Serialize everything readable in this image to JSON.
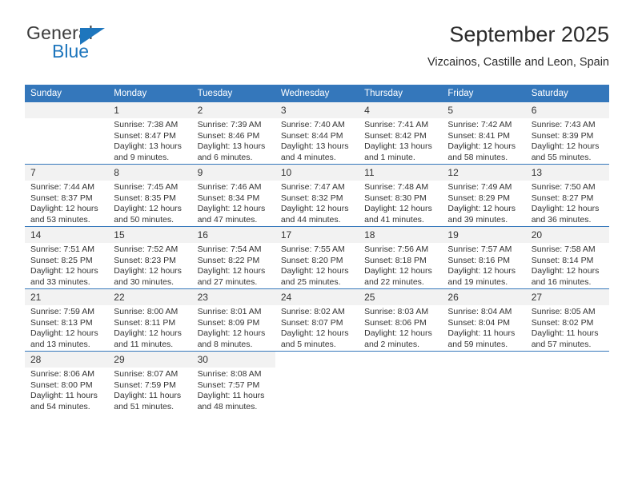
{
  "brand": {
    "name_part1": "General",
    "name_part2": "Blue",
    "triangle_color": "#1e76bd",
    "icon": "triangle-logo-icon"
  },
  "header": {
    "title": "September 2025",
    "subtitle": "Vizcainos, Castille and Leon, Spain"
  },
  "colors": {
    "header_blue": "#3477bb",
    "daynum_band": "#f2f2f2",
    "text": "#333333",
    "brand_blue": "#1e76bd"
  },
  "calendar": {
    "weekday_headers": [
      "Sunday",
      "Monday",
      "Tuesday",
      "Wednesday",
      "Thursday",
      "Friday",
      "Saturday"
    ],
    "labels": {
      "sunrise": "Sunrise:",
      "sunset": "Sunset:",
      "daylight": "Daylight:"
    },
    "weeks": [
      [
        {
          "day": "",
          "sunrise": "",
          "sunset": "",
          "daylight": ""
        },
        {
          "day": "1",
          "sunrise": "Sunrise: 7:38 AM",
          "sunset": "Sunset: 8:47 PM",
          "daylight": "Daylight: 13 hours and 9 minutes."
        },
        {
          "day": "2",
          "sunrise": "Sunrise: 7:39 AM",
          "sunset": "Sunset: 8:46 PM",
          "daylight": "Daylight: 13 hours and 6 minutes."
        },
        {
          "day": "3",
          "sunrise": "Sunrise: 7:40 AM",
          "sunset": "Sunset: 8:44 PM",
          "daylight": "Daylight: 13 hours and 4 minutes."
        },
        {
          "day": "4",
          "sunrise": "Sunrise: 7:41 AM",
          "sunset": "Sunset: 8:42 PM",
          "daylight": "Daylight: 13 hours and 1 minute."
        },
        {
          "day": "5",
          "sunrise": "Sunrise: 7:42 AM",
          "sunset": "Sunset: 8:41 PM",
          "daylight": "Daylight: 12 hours and 58 minutes."
        },
        {
          "day": "6",
          "sunrise": "Sunrise: 7:43 AM",
          "sunset": "Sunset: 8:39 PM",
          "daylight": "Daylight: 12 hours and 55 minutes."
        }
      ],
      [
        {
          "day": "7",
          "sunrise": "Sunrise: 7:44 AM",
          "sunset": "Sunset: 8:37 PM",
          "daylight": "Daylight: 12 hours and 53 minutes."
        },
        {
          "day": "8",
          "sunrise": "Sunrise: 7:45 AM",
          "sunset": "Sunset: 8:35 PM",
          "daylight": "Daylight: 12 hours and 50 minutes."
        },
        {
          "day": "9",
          "sunrise": "Sunrise: 7:46 AM",
          "sunset": "Sunset: 8:34 PM",
          "daylight": "Daylight: 12 hours and 47 minutes."
        },
        {
          "day": "10",
          "sunrise": "Sunrise: 7:47 AM",
          "sunset": "Sunset: 8:32 PM",
          "daylight": "Daylight: 12 hours and 44 minutes."
        },
        {
          "day": "11",
          "sunrise": "Sunrise: 7:48 AM",
          "sunset": "Sunset: 8:30 PM",
          "daylight": "Daylight: 12 hours and 41 minutes."
        },
        {
          "day": "12",
          "sunrise": "Sunrise: 7:49 AM",
          "sunset": "Sunset: 8:29 PM",
          "daylight": "Daylight: 12 hours and 39 minutes."
        },
        {
          "day": "13",
          "sunrise": "Sunrise: 7:50 AM",
          "sunset": "Sunset: 8:27 PM",
          "daylight": "Daylight: 12 hours and 36 minutes."
        }
      ],
      [
        {
          "day": "14",
          "sunrise": "Sunrise: 7:51 AM",
          "sunset": "Sunset: 8:25 PM",
          "daylight": "Daylight: 12 hours and 33 minutes."
        },
        {
          "day": "15",
          "sunrise": "Sunrise: 7:52 AM",
          "sunset": "Sunset: 8:23 PM",
          "daylight": "Daylight: 12 hours and 30 minutes."
        },
        {
          "day": "16",
          "sunrise": "Sunrise: 7:54 AM",
          "sunset": "Sunset: 8:22 PM",
          "daylight": "Daylight: 12 hours and 27 minutes."
        },
        {
          "day": "17",
          "sunrise": "Sunrise: 7:55 AM",
          "sunset": "Sunset: 8:20 PM",
          "daylight": "Daylight: 12 hours and 25 minutes."
        },
        {
          "day": "18",
          "sunrise": "Sunrise: 7:56 AM",
          "sunset": "Sunset: 8:18 PM",
          "daylight": "Daylight: 12 hours and 22 minutes."
        },
        {
          "day": "19",
          "sunrise": "Sunrise: 7:57 AM",
          "sunset": "Sunset: 8:16 PM",
          "daylight": "Daylight: 12 hours and 19 minutes."
        },
        {
          "day": "20",
          "sunrise": "Sunrise: 7:58 AM",
          "sunset": "Sunset: 8:14 PM",
          "daylight": "Daylight: 12 hours and 16 minutes."
        }
      ],
      [
        {
          "day": "21",
          "sunrise": "Sunrise: 7:59 AM",
          "sunset": "Sunset: 8:13 PM",
          "daylight": "Daylight: 12 hours and 13 minutes."
        },
        {
          "day": "22",
          "sunrise": "Sunrise: 8:00 AM",
          "sunset": "Sunset: 8:11 PM",
          "daylight": "Daylight: 12 hours and 11 minutes."
        },
        {
          "day": "23",
          "sunrise": "Sunrise: 8:01 AM",
          "sunset": "Sunset: 8:09 PM",
          "daylight": "Daylight: 12 hours and 8 minutes."
        },
        {
          "day": "24",
          "sunrise": "Sunrise: 8:02 AM",
          "sunset": "Sunset: 8:07 PM",
          "daylight": "Daylight: 12 hours and 5 minutes."
        },
        {
          "day": "25",
          "sunrise": "Sunrise: 8:03 AM",
          "sunset": "Sunset: 8:06 PM",
          "daylight": "Daylight: 12 hours and 2 minutes."
        },
        {
          "day": "26",
          "sunrise": "Sunrise: 8:04 AM",
          "sunset": "Sunset: 8:04 PM",
          "daylight": "Daylight: 11 hours and 59 minutes."
        },
        {
          "day": "27",
          "sunrise": "Sunrise: 8:05 AM",
          "sunset": "Sunset: 8:02 PM",
          "daylight": "Daylight: 11 hours and 57 minutes."
        }
      ],
      [
        {
          "day": "28",
          "sunrise": "Sunrise: 8:06 AM",
          "sunset": "Sunset: 8:00 PM",
          "daylight": "Daylight: 11 hours and 54 minutes."
        },
        {
          "day": "29",
          "sunrise": "Sunrise: 8:07 AM",
          "sunset": "Sunset: 7:59 PM",
          "daylight": "Daylight: 11 hours and 51 minutes."
        },
        {
          "day": "30",
          "sunrise": "Sunrise: 8:08 AM",
          "sunset": "Sunset: 7:57 PM",
          "daylight": "Daylight: 11 hours and 48 minutes."
        },
        {
          "day": "",
          "sunrise": "",
          "sunset": "",
          "daylight": ""
        },
        {
          "day": "",
          "sunrise": "",
          "sunset": "",
          "daylight": ""
        },
        {
          "day": "",
          "sunrise": "",
          "sunset": "",
          "daylight": ""
        },
        {
          "day": "",
          "sunrise": "",
          "sunset": "",
          "daylight": ""
        }
      ]
    ]
  }
}
